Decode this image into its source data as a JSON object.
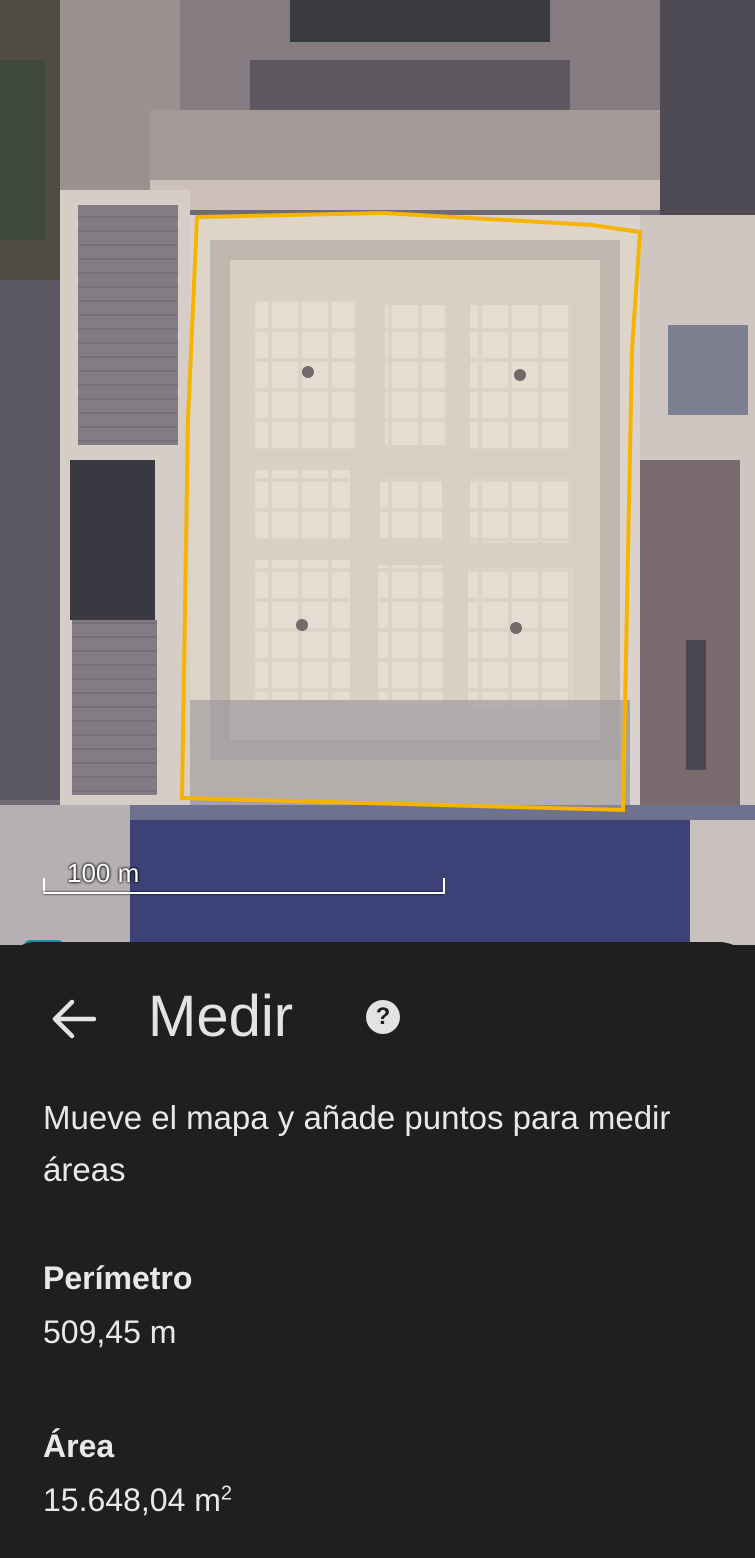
{
  "map": {
    "scale_label": "100 m",
    "polygon_color": "#f5b400"
  },
  "panel": {
    "title": "Medir",
    "back_icon": "arrow-left-icon",
    "help_icon": "question-mark-icon",
    "help_symbol": "?",
    "instructions": "Mueve el mapa y añade puntos para medir áreas",
    "perimeter_label": "Perímetro",
    "perimeter_value": "509,45 m",
    "area_label": "Área",
    "area_value": "15.648,04 m",
    "area_unit_superscript": "2"
  }
}
